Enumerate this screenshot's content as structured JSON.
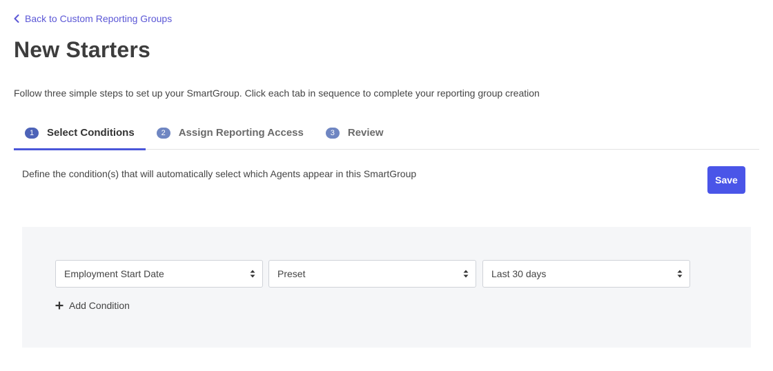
{
  "back_link": {
    "label": "Back to Custom Reporting Groups",
    "icon": "chevron-left-icon"
  },
  "page": {
    "title": "New Starters"
  },
  "intro": {
    "text": "Follow three simple steps to set up your SmartGroup. Click each tab in sequence to complete your reporting group creation"
  },
  "tabs": [
    {
      "num": "1",
      "label": "Select Conditions",
      "active": true
    },
    {
      "num": "2",
      "label": "Assign Reporting Access",
      "active": false
    },
    {
      "num": "3",
      "label": "Review",
      "active": false
    }
  ],
  "conditions": {
    "description": "Define the condition(s) that will automatically select which Agents appear in this SmartGroup",
    "save_label": "Save",
    "rows": [
      {
        "field": "Employment Start Date",
        "operator": "Preset",
        "value": "Last 30 days"
      }
    ],
    "add_label": "Add Condition"
  },
  "colors": {
    "accent": "#4a55e8",
    "link": "#5b57d6",
    "panel_bg": "#f5f6f8"
  }
}
